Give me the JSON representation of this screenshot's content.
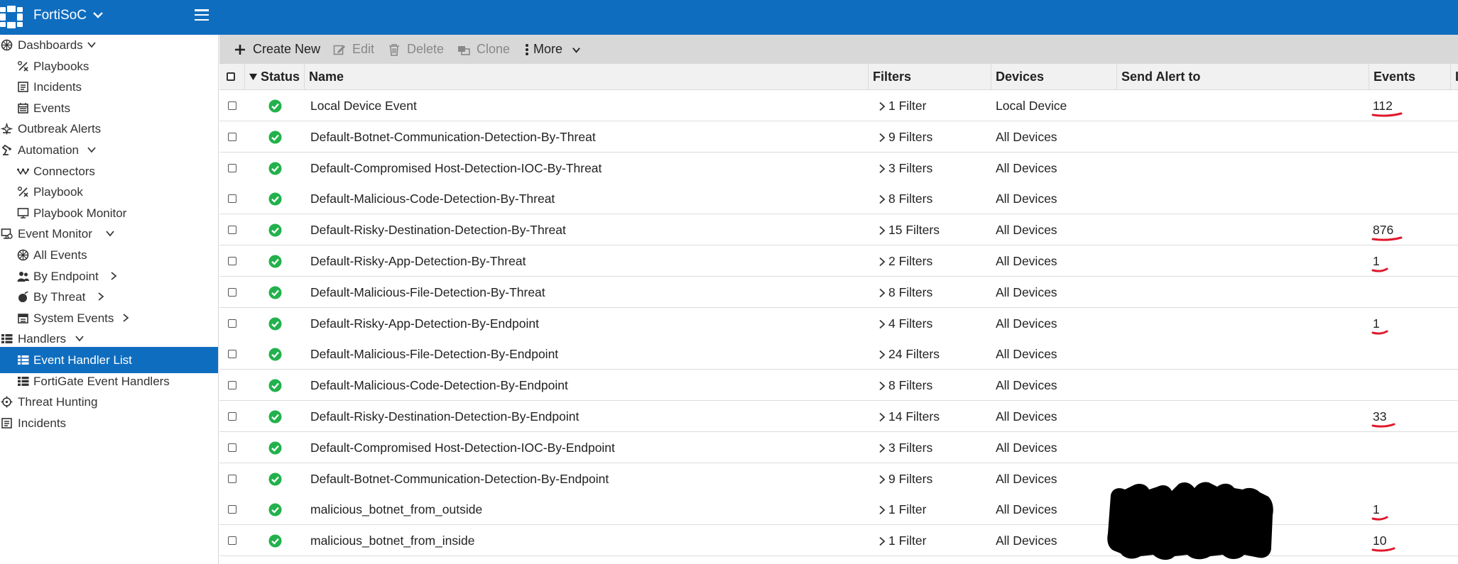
{
  "header": {
    "brand": "FortiSoC",
    "accent_color": "#0f6dbf"
  },
  "sidebar": {
    "items": [
      {
        "label": "Dashboards",
        "icon": "dashboard-icon",
        "level": 0,
        "chevron": "down"
      },
      {
        "label": "Playbooks",
        "icon": "playbook-icon",
        "level": 1
      },
      {
        "label": "Incidents",
        "icon": "incidents-icon",
        "level": 1
      },
      {
        "label": "Events",
        "icon": "events-icon",
        "level": 1
      },
      {
        "label": "Outbreak Alerts",
        "icon": "outbreak-icon",
        "level": 0
      },
      {
        "label": "Automation",
        "icon": "automation-icon",
        "level": 0,
        "chevron": "down"
      },
      {
        "label": "Connectors",
        "icon": "connectors-icon",
        "level": 1
      },
      {
        "label": "Playbook",
        "icon": "playbook-icon",
        "level": 1
      },
      {
        "label": "Playbook Monitor",
        "icon": "monitor-icon",
        "level": 1
      },
      {
        "label": "Event Monitor",
        "icon": "event-monitor-icon",
        "level": 0,
        "chevron": "down"
      },
      {
        "label": "All Events",
        "icon": "dashboard-icon",
        "level": 1
      },
      {
        "label": "By Endpoint",
        "icon": "endpoint-icon",
        "level": 1,
        "chevron": "right"
      },
      {
        "label": "By Threat",
        "icon": "threat-icon",
        "level": 1,
        "chevron": "right"
      },
      {
        "label": "System Events",
        "icon": "system-events-icon",
        "level": 1,
        "chevron": "right"
      },
      {
        "label": "Handlers",
        "icon": "list-icon",
        "level": 0,
        "chevron": "down"
      },
      {
        "label": "Event Handler List",
        "icon": "list-icon",
        "level": 1,
        "active": true
      },
      {
        "label": "FortiGate Event Handlers",
        "icon": "list-icon",
        "level": 1
      },
      {
        "label": "Threat Hunting",
        "icon": "hunting-icon",
        "level": 0
      },
      {
        "label": "Incidents",
        "icon": "incidents-icon",
        "level": 0
      }
    ]
  },
  "toolbar": {
    "create_new": "Create New",
    "edit": "Edit",
    "delete": "Delete",
    "clone": "Clone",
    "more": "More"
  },
  "table": {
    "columns": {
      "status": "Status",
      "name": "Name",
      "filters": "Filters",
      "devices": "Devices",
      "send_alert_to": "Send Alert to",
      "events": "Events",
      "extra": "Ir"
    },
    "rows": [
      {
        "name": "Local Device Event",
        "filters": "1 Filter",
        "devices": "Local Device",
        "send_alert_to": "",
        "events": "112",
        "status": "enabled"
      },
      {
        "name": "Default-Botnet-Communication-Detection-By-Threat",
        "filters": "9 Filters",
        "devices": "All Devices",
        "send_alert_to": "",
        "events": "",
        "status": "enabled"
      },
      {
        "name": "Default-Compromised Host-Detection-IOC-By-Threat",
        "filters": "3 Filters",
        "devices": "All Devices",
        "send_alert_to": "",
        "events": "",
        "status": "enabled"
      },
      {
        "name": "Default-Malicious-Code-Detection-By-Threat",
        "filters": "8 Filters",
        "devices": "All Devices",
        "send_alert_to": "",
        "events": "",
        "status": "enabled"
      },
      {
        "name": "Default-Risky-Destination-Detection-By-Threat",
        "filters": "15 Filters",
        "devices": "All Devices",
        "send_alert_to": "",
        "events": "876",
        "status": "enabled"
      },
      {
        "name": "Default-Risky-App-Detection-By-Threat",
        "filters": "2 Filters",
        "devices": "All Devices",
        "send_alert_to": "",
        "events": "1",
        "status": "enabled"
      },
      {
        "name": "Default-Malicious-File-Detection-By-Threat",
        "filters": "8 Filters",
        "devices": "All Devices",
        "send_alert_to": "",
        "events": "",
        "status": "enabled"
      },
      {
        "name": "Default-Risky-App-Detection-By-Endpoint",
        "filters": "4 Filters",
        "devices": "All Devices",
        "send_alert_to": "",
        "events": "1",
        "status": "enabled"
      },
      {
        "name": "Default-Malicious-File-Detection-By-Endpoint",
        "filters": "24 Filters",
        "devices": "All Devices",
        "send_alert_to": "",
        "events": "",
        "status": "enabled"
      },
      {
        "name": "Default-Malicious-Code-Detection-By-Endpoint",
        "filters": "8 Filters",
        "devices": "All Devices",
        "send_alert_to": "",
        "events": "",
        "status": "enabled"
      },
      {
        "name": "Default-Risky-Destination-Detection-By-Endpoint",
        "filters": "14 Filters",
        "devices": "All Devices",
        "send_alert_to": "",
        "events": "33",
        "status": "enabled"
      },
      {
        "name": "Default-Compromised Host-Detection-IOC-By-Endpoint",
        "filters": "3 Filters",
        "devices": "All Devices",
        "send_alert_to": "",
        "events": "",
        "status": "enabled"
      },
      {
        "name": "Default-Botnet-Communication-Detection-By-Endpoint",
        "filters": "9 Filters",
        "devices": "All Devices",
        "send_alert_to": "",
        "events": "",
        "status": "enabled"
      },
      {
        "name": "malicious_botnet_from_outside",
        "filters": "1 Filter",
        "devices": "All Devices",
        "send_alert_to": "",
        "events": "1",
        "status": "enabled"
      },
      {
        "name": "malicious_botnet_from_inside",
        "filters": "1 Filter",
        "devices": "All Devices",
        "send_alert_to": "",
        "events": "10",
        "status": "enabled"
      }
    ]
  },
  "colors": {
    "status_ok": "#22b14c",
    "annotation": "#e0182a",
    "redaction": "#000000"
  }
}
